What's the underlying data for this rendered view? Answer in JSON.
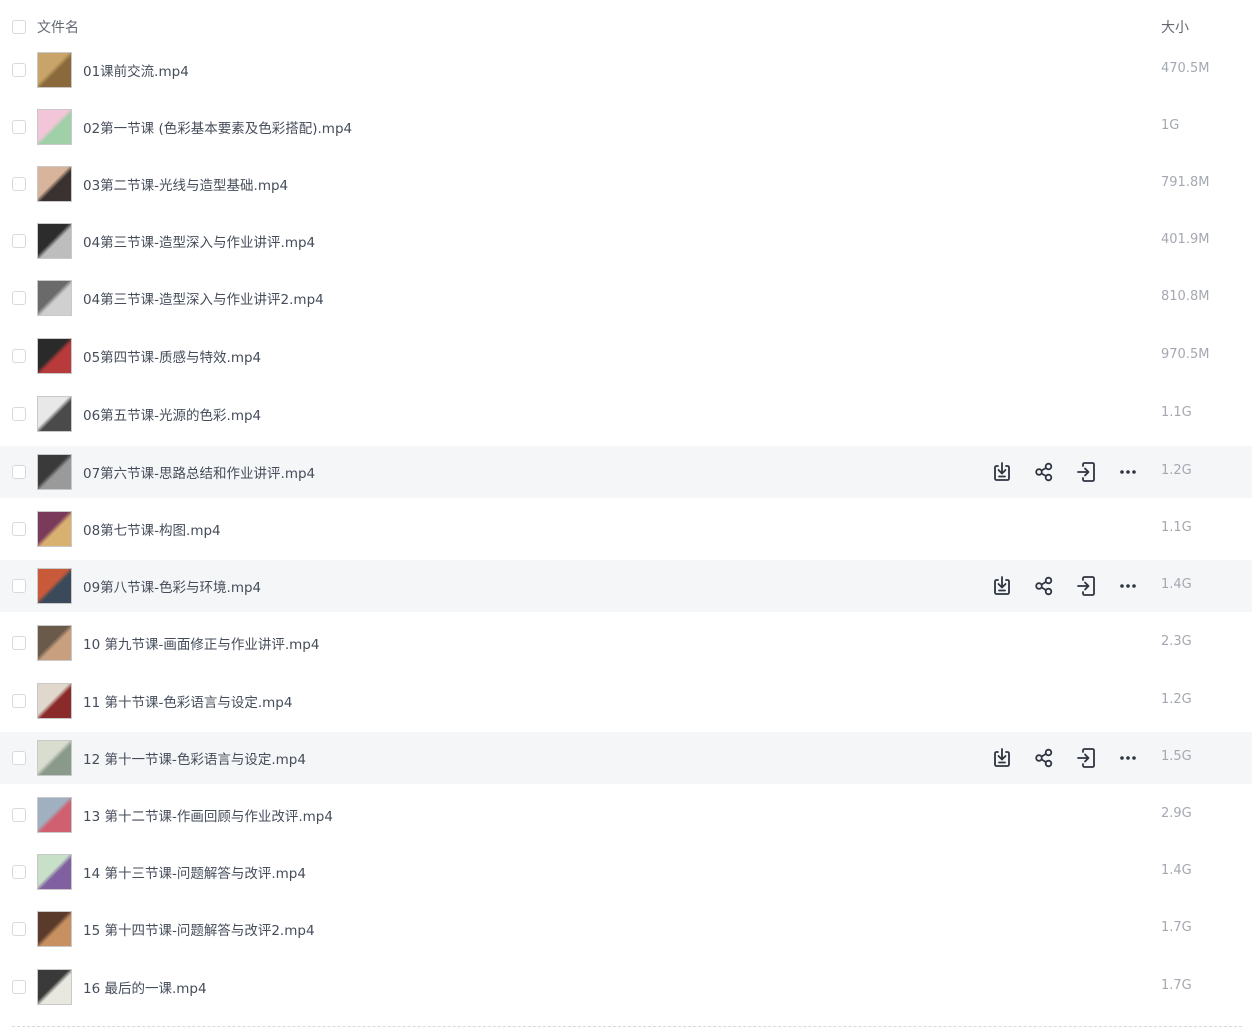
{
  "header": {
    "name_label": "文件名",
    "size_label": "大小"
  },
  "files": [
    {
      "name": "01课前交流.mp4",
      "size": "470.5M",
      "thumb": [
        "#c9a46a",
        "#8a6a3c"
      ]
    },
    {
      "name": "02第一节课 (色彩基本要素及色彩搭配).mp4",
      "size": "1G",
      "thumb": [
        "#f2c6d8",
        "#9fd0a8"
      ]
    },
    {
      "name": "03第二节课-光线与造型基础.mp4",
      "size": "791.8M",
      "thumb": [
        "#d8b49c",
        "#3a3230"
      ]
    },
    {
      "name": "04第三节课-造型深入与作业讲评.mp4",
      "size": "401.9M",
      "thumb": [
        "#2c2c2c",
        "#bdbdbd"
      ]
    },
    {
      "name": "04第三节课-造型深入与作业讲评2.mp4",
      "size": "810.8M",
      "thumb": [
        "#6a6a6a",
        "#d0d0d0"
      ]
    },
    {
      "name": "05第四节课-质感与特效.mp4",
      "size": "970.5M",
      "thumb": [
        "#2a2a2a",
        "#b83a3a"
      ]
    },
    {
      "name": "06第五节课-光源的色彩.mp4",
      "size": "1.1G",
      "thumb": [
        "#e8e8e8",
        "#4a4a4a"
      ]
    },
    {
      "name": "07第六节课-思路总结和作业讲评.mp4",
      "size": "1.2G",
      "thumb": [
        "#3a3a3a",
        "#9a9a9a"
      ],
      "hover": true
    },
    {
      "name": "08第七节课-构图.mp4",
      "size": "1.1G",
      "thumb": [
        "#7a3a5a",
        "#d8b070"
      ]
    },
    {
      "name": "09第八节课-色彩与环境.mp4",
      "size": "1.4G",
      "thumb": [
        "#c85a3a",
        "#3a4a5a"
      ],
      "hover": true
    },
    {
      "name": "10 第九节课-画面修正与作业讲评.mp4",
      "size": "2.3G",
      "thumb": [
        "#6a5a4a",
        "#c8a080"
      ]
    },
    {
      "name": "11 第十节课-色彩语言与设定.mp4",
      "size": "1.2G",
      "thumb": [
        "#e0d8cc",
        "#8a2a2a"
      ]
    },
    {
      "name": "12 第十一节课-色彩语言与设定.mp4",
      "size": "1.5G",
      "thumb": [
        "#d8ddd0",
        "#8a9a8a"
      ],
      "hover": true
    },
    {
      "name": "13 第十二节课-作画回顾与作业改评.mp4",
      "size": "2.9G",
      "thumb": [
        "#a0b0c0",
        "#d06070"
      ]
    },
    {
      "name": "14 第十三节课-问题解答与改评.mp4",
      "size": "1.4G",
      "thumb": [
        "#c8e0c8",
        "#8060a0"
      ]
    },
    {
      "name": "15 第十四节课-问题解答与改评2.mp4",
      "size": "1.7G",
      "thumb": [
        "#5a3a2a",
        "#c89060"
      ]
    },
    {
      "name": "16 最后的一课.mp4",
      "size": "1.7G",
      "thumb": [
        "#3a3a3a",
        "#e8e8e0"
      ]
    }
  ],
  "row_actions": [
    "download-icon",
    "share-icon",
    "move-icon",
    "more-icon"
  ]
}
